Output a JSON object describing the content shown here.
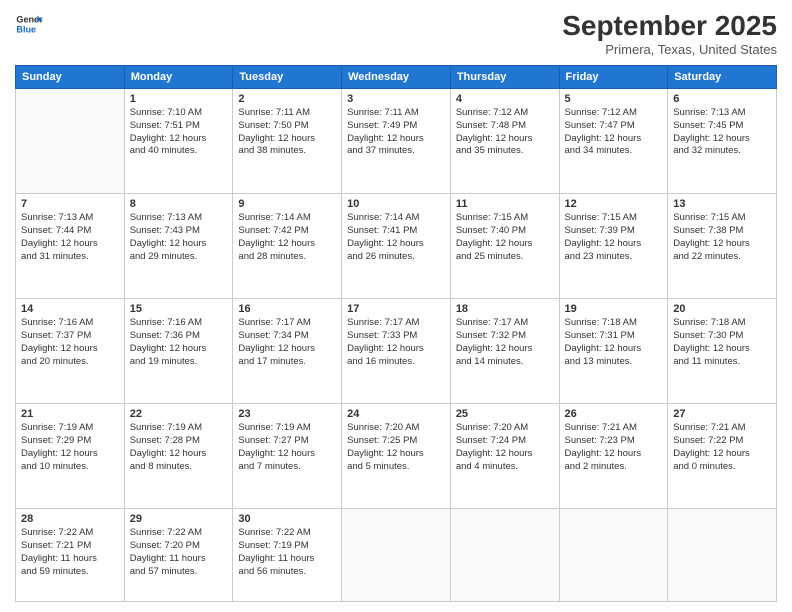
{
  "header": {
    "logo_line1": "General",
    "logo_line2": "Blue",
    "month": "September 2025",
    "location": "Primera, Texas, United States"
  },
  "days_of_week": [
    "Sunday",
    "Monday",
    "Tuesday",
    "Wednesday",
    "Thursday",
    "Friday",
    "Saturday"
  ],
  "weeks": [
    [
      {
        "day": "",
        "info": ""
      },
      {
        "day": "1",
        "info": "Sunrise: 7:10 AM\nSunset: 7:51 PM\nDaylight: 12 hours\nand 40 minutes."
      },
      {
        "day": "2",
        "info": "Sunrise: 7:11 AM\nSunset: 7:50 PM\nDaylight: 12 hours\nand 38 minutes."
      },
      {
        "day": "3",
        "info": "Sunrise: 7:11 AM\nSunset: 7:49 PM\nDaylight: 12 hours\nand 37 minutes."
      },
      {
        "day": "4",
        "info": "Sunrise: 7:12 AM\nSunset: 7:48 PM\nDaylight: 12 hours\nand 35 minutes."
      },
      {
        "day": "5",
        "info": "Sunrise: 7:12 AM\nSunset: 7:47 PM\nDaylight: 12 hours\nand 34 minutes."
      },
      {
        "day": "6",
        "info": "Sunrise: 7:13 AM\nSunset: 7:45 PM\nDaylight: 12 hours\nand 32 minutes."
      }
    ],
    [
      {
        "day": "7",
        "info": "Sunrise: 7:13 AM\nSunset: 7:44 PM\nDaylight: 12 hours\nand 31 minutes."
      },
      {
        "day": "8",
        "info": "Sunrise: 7:13 AM\nSunset: 7:43 PM\nDaylight: 12 hours\nand 29 minutes."
      },
      {
        "day": "9",
        "info": "Sunrise: 7:14 AM\nSunset: 7:42 PM\nDaylight: 12 hours\nand 28 minutes."
      },
      {
        "day": "10",
        "info": "Sunrise: 7:14 AM\nSunset: 7:41 PM\nDaylight: 12 hours\nand 26 minutes."
      },
      {
        "day": "11",
        "info": "Sunrise: 7:15 AM\nSunset: 7:40 PM\nDaylight: 12 hours\nand 25 minutes."
      },
      {
        "day": "12",
        "info": "Sunrise: 7:15 AM\nSunset: 7:39 PM\nDaylight: 12 hours\nand 23 minutes."
      },
      {
        "day": "13",
        "info": "Sunrise: 7:15 AM\nSunset: 7:38 PM\nDaylight: 12 hours\nand 22 minutes."
      }
    ],
    [
      {
        "day": "14",
        "info": "Sunrise: 7:16 AM\nSunset: 7:37 PM\nDaylight: 12 hours\nand 20 minutes."
      },
      {
        "day": "15",
        "info": "Sunrise: 7:16 AM\nSunset: 7:36 PM\nDaylight: 12 hours\nand 19 minutes."
      },
      {
        "day": "16",
        "info": "Sunrise: 7:17 AM\nSunset: 7:34 PM\nDaylight: 12 hours\nand 17 minutes."
      },
      {
        "day": "17",
        "info": "Sunrise: 7:17 AM\nSunset: 7:33 PM\nDaylight: 12 hours\nand 16 minutes."
      },
      {
        "day": "18",
        "info": "Sunrise: 7:17 AM\nSunset: 7:32 PM\nDaylight: 12 hours\nand 14 minutes."
      },
      {
        "day": "19",
        "info": "Sunrise: 7:18 AM\nSunset: 7:31 PM\nDaylight: 12 hours\nand 13 minutes."
      },
      {
        "day": "20",
        "info": "Sunrise: 7:18 AM\nSunset: 7:30 PM\nDaylight: 12 hours\nand 11 minutes."
      }
    ],
    [
      {
        "day": "21",
        "info": "Sunrise: 7:19 AM\nSunset: 7:29 PM\nDaylight: 12 hours\nand 10 minutes."
      },
      {
        "day": "22",
        "info": "Sunrise: 7:19 AM\nSunset: 7:28 PM\nDaylight: 12 hours\nand 8 minutes."
      },
      {
        "day": "23",
        "info": "Sunrise: 7:19 AM\nSunset: 7:27 PM\nDaylight: 12 hours\nand 7 minutes."
      },
      {
        "day": "24",
        "info": "Sunrise: 7:20 AM\nSunset: 7:25 PM\nDaylight: 12 hours\nand 5 minutes."
      },
      {
        "day": "25",
        "info": "Sunrise: 7:20 AM\nSunset: 7:24 PM\nDaylight: 12 hours\nand 4 minutes."
      },
      {
        "day": "26",
        "info": "Sunrise: 7:21 AM\nSunset: 7:23 PM\nDaylight: 12 hours\nand 2 minutes."
      },
      {
        "day": "27",
        "info": "Sunrise: 7:21 AM\nSunset: 7:22 PM\nDaylight: 12 hours\nand 0 minutes."
      }
    ],
    [
      {
        "day": "28",
        "info": "Sunrise: 7:22 AM\nSunset: 7:21 PM\nDaylight: 11 hours\nand 59 minutes."
      },
      {
        "day": "29",
        "info": "Sunrise: 7:22 AM\nSunset: 7:20 PM\nDaylight: 11 hours\nand 57 minutes."
      },
      {
        "day": "30",
        "info": "Sunrise: 7:22 AM\nSunset: 7:19 PM\nDaylight: 11 hours\nand 56 minutes."
      },
      {
        "day": "",
        "info": ""
      },
      {
        "day": "",
        "info": ""
      },
      {
        "day": "",
        "info": ""
      },
      {
        "day": "",
        "info": ""
      }
    ]
  ]
}
